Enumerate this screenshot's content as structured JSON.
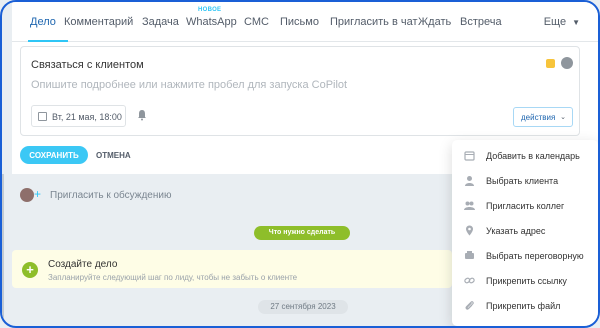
{
  "tabs": [
    {
      "label": "Дело",
      "active": true
    },
    {
      "label": "Комментарий"
    },
    {
      "label": "Задача"
    },
    {
      "label": "WhatsApp",
      "badge": "НОВОЕ"
    },
    {
      "label": "СМС"
    },
    {
      "label": "Письмо"
    },
    {
      "label": "Пригласить в чат"
    },
    {
      "label": "Ждать"
    },
    {
      "label": "Встреча"
    }
  ],
  "more_label": "Еще",
  "editor": {
    "subject": "Связаться с клиентом",
    "placeholder": "Опишите подробнее или нажмите пробел для запуска CoPilot",
    "date": "Вт, 21 мая, 18:00",
    "actions_label": "действия",
    "save_label": "СОХРАНИТЬ",
    "cancel_label": "ОТМЕНА"
  },
  "timeline": {
    "invite_label": "Пригласить к обсуждению",
    "todo_badge": "Что нужно сделать",
    "todo_title": "Создайте дело",
    "todo_hint": "Запланируйте следующий шаг по лиду, чтобы не забыть о клиенте",
    "date_badge": "27 сентября 2023"
  },
  "menu": {
    "items": [
      {
        "label": "Добавить в календарь",
        "icon": "calendar-icon"
      },
      {
        "label": "Выбрать клиента",
        "icon": "person-icon"
      },
      {
        "label": "Пригласить коллег",
        "icon": "people-icon"
      },
      {
        "label": "Указать адрес",
        "icon": "location-pin-icon"
      },
      {
        "label": "Выбрать переговорную",
        "icon": "meeting-room-icon"
      },
      {
        "label": "Прикрепить ссылку",
        "icon": "link-icon"
      },
      {
        "label": "Прикрепить файл",
        "icon": "paperclip-icon"
      }
    ]
  },
  "colors": {
    "accent": "#2fc6f6",
    "save": "#3bc8f5",
    "todo_green": "#8ebe2a",
    "frame": "#1a5fd6"
  }
}
